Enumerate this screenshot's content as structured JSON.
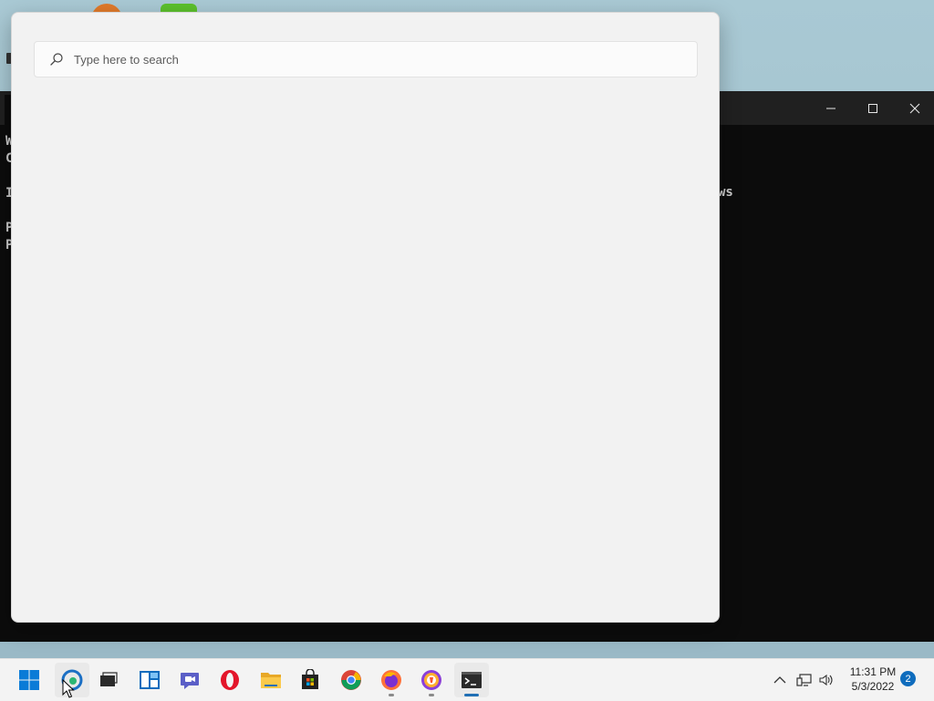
{
  "search": {
    "placeholder": "Type here to search",
    "value": ""
  },
  "terminal": {
    "lines": [
      "W",
      "C",
      "",
      "I",
      "",
      "P",
      "P"
    ],
    "partial_text": "ws",
    "buttons": {
      "minimize_icon": "minimize-icon",
      "maximize_icon": "maximize-icon",
      "close_icon": "close-icon"
    }
  },
  "taskbar": {
    "apps": [
      {
        "name": "start",
        "icon": "windows-logo-icon"
      },
      {
        "name": "microsoft-edge",
        "icon": "edge-icon"
      },
      {
        "name": "task-view",
        "icon": "task-view-icon"
      },
      {
        "name": "widgets",
        "icon": "widgets-icon"
      },
      {
        "name": "teams-chat",
        "icon": "chat-icon"
      },
      {
        "name": "opera",
        "icon": "opera-icon"
      },
      {
        "name": "file-explorer",
        "icon": "folder-icon"
      },
      {
        "name": "microsoft-store",
        "icon": "store-icon"
      },
      {
        "name": "google-chrome",
        "icon": "chrome-icon"
      },
      {
        "name": "firefox",
        "icon": "firefox-icon"
      },
      {
        "name": "brave",
        "icon": "brave-icon"
      },
      {
        "name": "terminal",
        "icon": "terminal-icon"
      }
    ],
    "tray": {
      "time": "11:31 PM",
      "date": "5/3/2022",
      "notification_count": "2"
    }
  },
  "colors": {
    "panel_bg": "#f2f2f2",
    "taskbar_bg": "#f3f3f3",
    "terminal_bg": "#0c0c0c",
    "accent": "#0f6cbd"
  }
}
